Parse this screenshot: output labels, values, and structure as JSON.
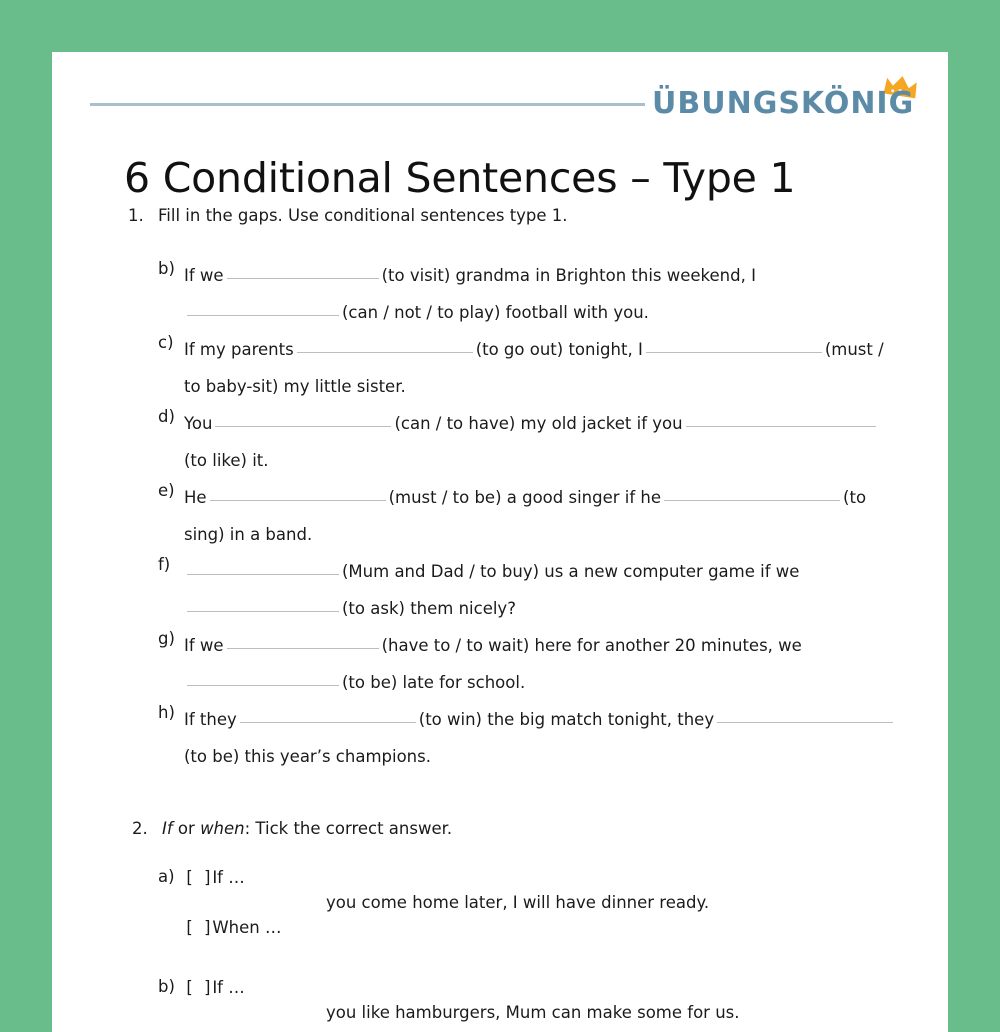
{
  "page": {
    "background_color": "#68bd8b",
    "paper_color": "#ffffff"
  },
  "header": {
    "rule_color": "#a9bfce",
    "logo": {
      "text": "ÜBUNGSKÖNIG",
      "text_color": "#5b8ba6",
      "crown_color": "#f5a623",
      "crown_icon": "crown-icon"
    }
  },
  "title": "6 Conditional Sentences – Type 1",
  "exercises": [
    {
      "number": "1.",
      "instruction": "Fill in the gaps. Use conditional sentences type 1.",
      "items": [
        {
          "label": "b)",
          "line1_pre": "If we",
          "line1_post": "(to visit) grandma in Brighton this weekend, I",
          "line2_post": "(can / not / to play) football with you."
        },
        {
          "label": "c)",
          "line1_pre": "If my parents",
          "line1_mid": "(to go out) tonight, I",
          "line1_post": "(must /",
          "line2": "to baby-sit) my little sister."
        },
        {
          "label": "d)",
          "line1_pre": "You",
          "line1_mid": "(can / to have) my old jacket if you",
          "line2": "(to like) it."
        },
        {
          "label": "e)",
          "line1_pre": "He",
          "line1_mid": "(must / to be) a good singer if he",
          "line1_post": "(to",
          "line2": "sing) in a band."
        },
        {
          "label": "f)",
          "line1_post": "(Mum and Dad / to buy) us a new computer game if we",
          "line2_post": "(to ask) them nicely?"
        },
        {
          "label": "g)",
          "line1_pre": "If we",
          "line1_post": "(have to / to wait) here for another 20 minutes, we",
          "line2_post": "(to be) late for school."
        },
        {
          "label": "h)",
          "line1_pre": "If they",
          "line1_mid": "(to win) the big match tonight, they",
          "line2": "(to be) this year’s champions."
        }
      ]
    },
    {
      "number": "2.",
      "instruction_part1": "If",
      "instruction_or": " or ",
      "instruction_part2": "when",
      "instruction_part3": ": Tick the correct answer.",
      "items": [
        {
          "label": "a)",
          "option1_box": "[   ]",
          "option1_text": "If …",
          "sentence": "you come home later, I will have dinner ready.",
          "option2_box": "[   ]",
          "option2_text": "When …"
        },
        {
          "label": "b)",
          "option1_box": "[   ]",
          "option1_text": "If …",
          "sentence": "you like hamburgers, Mum can make some for us."
        }
      ]
    }
  ]
}
